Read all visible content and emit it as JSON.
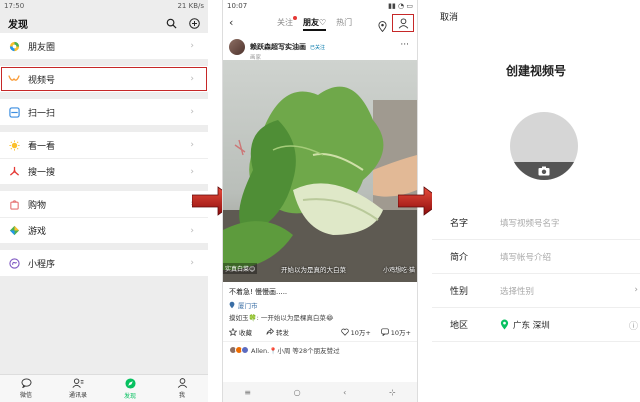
{
  "discover": {
    "status_time": "17:50",
    "status_right": "21 KB/s",
    "title": "发现",
    "groups": [
      [
        {
          "label": "朋友圈",
          "icon": "moments-icon"
        }
      ],
      [
        {
          "label": "视频号",
          "icon": "channels-icon",
          "highlight": true
        }
      ],
      [
        {
          "label": "扫一扫",
          "icon": "scan-icon"
        }
      ],
      [
        {
          "label": "看一看",
          "icon": "top-stories-icon"
        },
        {
          "label": "搜一搜",
          "icon": "search-feature-icon"
        }
      ],
      [
        {
          "label": "购物",
          "icon": "shopping-icon"
        },
        {
          "label": "游戏",
          "icon": "games-icon"
        }
      ],
      [
        {
          "label": "小程序",
          "icon": "mini-programs-icon"
        }
      ]
    ],
    "tabs": [
      {
        "label": "微信",
        "icon": "chats-icon"
      },
      {
        "label": "通讯录",
        "icon": "contacts-icon"
      },
      {
        "label": "发现",
        "icon": "discover-icon",
        "active": true
      },
      {
        "label": "我",
        "icon": "me-icon"
      }
    ]
  },
  "feed": {
    "status_time": "10:07",
    "tabs": [
      "关注",
      "朋友♡",
      "热门"
    ],
    "author_name": "赖跃森超写实油画",
    "author_badge": "已关注",
    "author_sub": "画家",
    "caption_left": "实真白菜😊",
    "caption_mid": "开始以为是真的大白菜",
    "caption_right": "小鸡想吃·猫",
    "post_text": "不着急! 慢慢画.....",
    "location": "厦门市",
    "comment": "摸如玉🍀: 一开始以为是棵真白菜😂",
    "actions": {
      "save": "收藏",
      "share": "转发",
      "likes": "10万+",
      "comments": "10万+"
    },
    "likers": "Allen.📍小周 等28个朋友赞过",
    "sysbar": [
      "≡",
      "○",
      "‹",
      "⊹"
    ]
  },
  "create": {
    "cancel": "取消",
    "title": "创建视频号",
    "fields": [
      {
        "label": "名字",
        "value": "填写视频号名字",
        "end": ""
      },
      {
        "label": "简介",
        "value": "填写帐号介绍",
        "end": ""
      },
      {
        "label": "性别",
        "value": "选择性别",
        "end": "›"
      },
      {
        "label": "地区",
        "value": "广东 深圳",
        "end": "ⓘ"
      }
    ]
  },
  "colors": {
    "accent": "#07c160",
    "highlight": "#c62828",
    "arrow": "#c41a1a"
  }
}
